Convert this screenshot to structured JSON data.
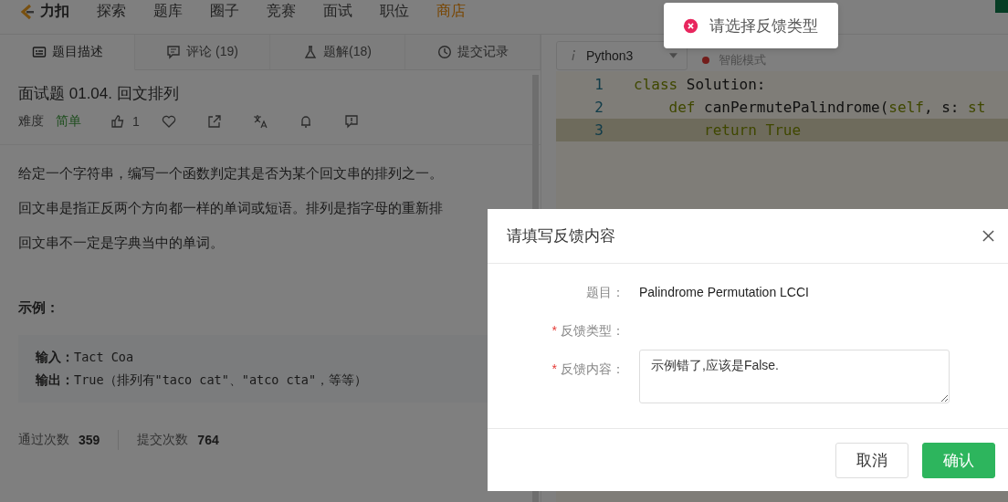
{
  "nav": {
    "logo": "力扣",
    "items": [
      {
        "label": "探索",
        "kind": "link"
      },
      {
        "label": "题库",
        "kind": "link"
      },
      {
        "label": "圈子",
        "kind": "link"
      },
      {
        "label": "竞赛",
        "kind": "link"
      },
      {
        "label": "面试",
        "kind": "link"
      },
      {
        "label": "职位",
        "kind": "link"
      },
      {
        "label": "商店",
        "kind": "shop"
      }
    ]
  },
  "tabs": [
    {
      "label": "题目描述",
      "selected": true
    },
    {
      "label": "评论 (19)",
      "selected": false
    },
    {
      "label": "题解(18)",
      "selected": false
    },
    {
      "label": "提交记录",
      "selected": false
    }
  ],
  "problem": {
    "title": "面试题 01.04. 回文排列",
    "difficulty_label": "难度",
    "difficulty": "简单",
    "likes": "1",
    "paragraphs": [
      "给定一个字符串，编写一个函数判定其是否为某个回文串的排列之一。",
      "回文串是指正反两个方向都一样的单词或短语。排列是指字母的重新排",
      "回文串不一定是字典当中的单词。"
    ],
    "example_heading": "示例：",
    "example": [
      {
        "label": "输入：",
        "value": "Tact Coa"
      },
      {
        "label": "输出：",
        "value": "True（排列有\"taco cat\"、\"atco cta\"，等等）"
      }
    ],
    "stats": [
      {
        "label": "通过次数",
        "value": "359"
      },
      {
        "label": "提交次数",
        "value": "764"
      }
    ]
  },
  "editor": {
    "language": "Python3",
    "mode": "智能模式",
    "lines": [
      {
        "number": "1",
        "current": false,
        "tokens": [
          {
            "text": "class",
            "kind": "keyword"
          },
          {
            "text": " Solution:",
            "kind": "plain"
          }
        ]
      },
      {
        "number": "2",
        "current": false,
        "tokens": [
          {
            "text": "    def",
            "kind": "keyword"
          },
          {
            "text": " canPermutePalindrome(",
            "kind": "plain"
          },
          {
            "text": "self",
            "kind": "keyword"
          },
          {
            "text": ", s: ",
            "kind": "plain"
          },
          {
            "text": "st",
            "kind": "keyword"
          }
        ]
      },
      {
        "number": "3",
        "current": true,
        "tokens": [
          {
            "text": "        return True",
            "kind": "keyword"
          }
        ]
      }
    ]
  },
  "toast": {
    "kind": "error",
    "message": "请选择反馈类型"
  },
  "dialog": {
    "title": "请填写反馈内容",
    "fields": [
      {
        "label": "题目：",
        "kind": "text",
        "value": "Palindrome Permutation LCCI"
      },
      {
        "marker": "*",
        "label": "反馈类型：",
        "kind": "empty"
      },
      {
        "marker": "*",
        "label": "反馈内容：",
        "kind": "textarea",
        "value": "示例错了,应该是False."
      }
    ],
    "buttons": [
      {
        "label": "取消",
        "kind": "secondary"
      },
      {
        "label": "确认",
        "kind": "primary"
      }
    ]
  }
}
